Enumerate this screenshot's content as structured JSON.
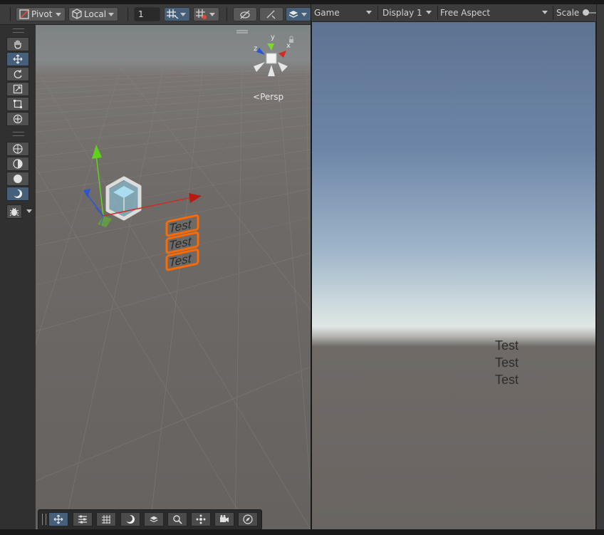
{
  "scene_toolbar": {
    "pivot_label": "Pivot",
    "local_label": "Local",
    "grid_size_value": "1"
  },
  "scene_view": {
    "projection_label": "Persp",
    "gizmo_axes": {
      "x": "x",
      "y": "y",
      "z": "z"
    },
    "text_objects": [
      "Test",
      "Test",
      "Test"
    ]
  },
  "game_toolbar": {
    "view_dropdown": "Game",
    "display_dropdown": "Display 1",
    "aspect_dropdown": "Free Aspect",
    "scale_label": "Scale"
  },
  "game_view": {
    "text_lines": [
      "Test",
      "Test",
      "Test"
    ]
  },
  "colors": {
    "accent_active": "#46607c",
    "selection_outline": "#ff6a00",
    "x_axis": "#d22a20",
    "y_axis": "#5fd21a",
    "z_axis": "#2a55d8"
  }
}
